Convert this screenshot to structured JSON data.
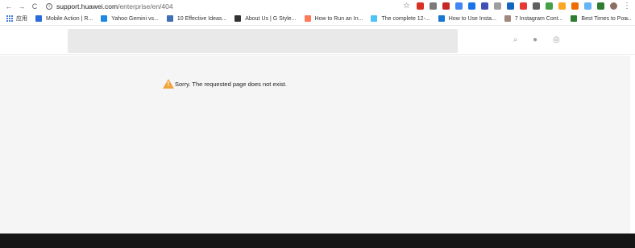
{
  "browser": {
    "url_host": "support.huawei.com",
    "url_path": "/enterprise/en/404",
    "back_glyph": "←",
    "forward_glyph": "→",
    "reload_glyph": "C",
    "info_glyph": "i",
    "star_glyph": "☆",
    "menu_glyph": "⋮",
    "extensions": [
      {
        "icon": "ext-icon-1",
        "color": "#d93025"
      },
      {
        "icon": "ext-icon-2",
        "color": "#7a7a7a"
      },
      {
        "icon": "ext-icon-3",
        "color": "#c62828"
      },
      {
        "icon": "ext-icon-4",
        "color": "#4285f4"
      },
      {
        "icon": "ext-icon-5",
        "color": "#1a73e8"
      },
      {
        "icon": "ext-icon-6",
        "color": "#3f51b5"
      },
      {
        "icon": "ext-icon-7",
        "color": "#9e9e9e"
      },
      {
        "icon": "ext-icon-8",
        "color": "#1565c0"
      },
      {
        "icon": "ext-icon-9",
        "color": "#e53935"
      },
      {
        "icon": "ext-icon-10",
        "color": "#616161"
      },
      {
        "icon": "ext-icon-11",
        "color": "#43a047"
      },
      {
        "icon": "ext-icon-12",
        "color": "#f9a825"
      },
      {
        "icon": "ext-icon-13",
        "color": "#ef6c00"
      },
      {
        "icon": "ext-icon-14",
        "color": "#64b5f6"
      },
      {
        "icon": "ext-icon-15",
        "color": "#2e7d32"
      },
      {
        "icon": "profile-avatar-icon",
        "color": "#8d6e63"
      }
    ]
  },
  "bookmarks": {
    "apps_label": "应用",
    "items": [
      {
        "label": "Mobile Action | R...",
        "icon": "rocket-icon",
        "color": "#2b6cd8"
      },
      {
        "label": "Yahoo Gemini vs...",
        "icon": "pencil-icon",
        "color": "#1e88e5"
      },
      {
        "label": "10 Effective Ideas...",
        "icon": "chart-icon",
        "color": "#3f6fb5"
      },
      {
        "label": "About Us | G Style...",
        "icon": "g-style-icon",
        "color": "#333333"
      },
      {
        "label": "How to Run an In...",
        "icon": "hubspot-icon",
        "color": "#ff7a59"
      },
      {
        "label": "The complete 12-...",
        "icon": "cloud-icon",
        "color": "#4fc3f7"
      },
      {
        "label": "How to Use Insta...",
        "icon": "wave-icon",
        "color": "#1976d2"
      },
      {
        "label": "7 Instagram Cont...",
        "icon": "avatar-icon",
        "color": "#a1887f"
      },
      {
        "label": "Best Times to Pos...",
        "icon": "flag-icon",
        "color": "#2e7d32"
      }
    ],
    "more_glyph": "»"
  },
  "header": {
    "search_glyph": "⌕",
    "user_glyph": "●",
    "globe_glyph": "◎"
  },
  "main": {
    "error_message": "Sorry. The requested page does not exist.",
    "warning_color": "#f0a43a"
  }
}
